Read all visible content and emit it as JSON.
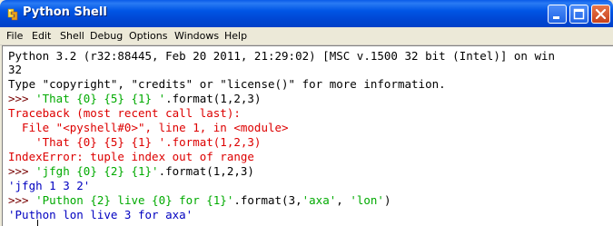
{
  "window": {
    "title": "Python Shell"
  },
  "menu": [
    "File",
    "Edit",
    "Shell",
    "Debug",
    "Options",
    "Windows",
    "Help"
  ],
  "shell": {
    "banner_line1": "Python 3.2 (r32:88445, Feb 20 2011, 21:29:02) [MSC v.1500 32 bit (Intel)] on win",
    "banner_line2": "32",
    "banner_line3": "Type \"copyright\", \"credits\" or \"license()\" for more information.",
    "prompt": ">>> ",
    "cmd1_string": "'That {0} {5} {1} '",
    "cmd1_rest": ".format(1,2,3)",
    "traceback_header": "Traceback (most recent call last):",
    "traceback_file": "  File \"<pyshell#0>\", line 1, in <module>",
    "traceback_source": "    'That {0} {5} {1} '.format(1,2,3)",
    "error_message": "IndexError: tuple index out of range",
    "cmd2_string": "'jfgh {0} {2} {1}'",
    "cmd2_rest": ".format(1,2,3)",
    "output2": "'jfgh 1 3 2'",
    "cmd3_string1": "'Puthon {2} live {0} for {1}'",
    "cmd3_rest1": ".format(3,",
    "cmd3_string2": "'axa'",
    "cmd3_rest2": ", ",
    "cmd3_string3": "'lon'",
    "cmd3_rest3": ")",
    "output3": "'Puthon lon live 3 for axa'"
  },
  "colors": {
    "title_bar": "#0055e5",
    "prompt": "#770000",
    "string": "#00aa00",
    "error": "#dd0000",
    "output": "#0000c0"
  },
  "icons": [
    "python-logo-icon",
    "minimize-icon",
    "maximize-icon",
    "close-icon"
  ]
}
